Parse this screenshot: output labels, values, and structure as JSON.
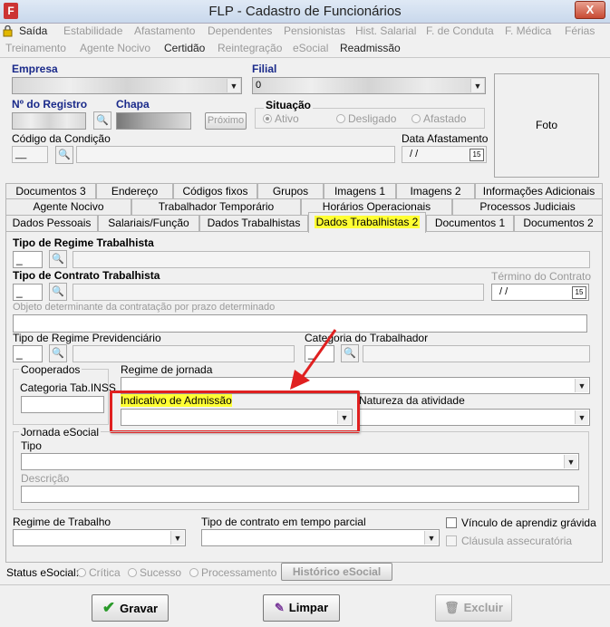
{
  "window": {
    "title": "FLP - Cadastro de Funcionários",
    "close_label": "X",
    "icon_label": "F"
  },
  "menu": {
    "row1": [
      "Saída",
      "Estabilidade",
      "Afastamento",
      "Dependentes",
      "Pensionistas",
      "Hist. Salarial",
      "F. de Conduta",
      "F. Médica",
      "Férias"
    ],
    "row2": [
      "Treinamento",
      "Agente Nocivo",
      "Certidão",
      "Reintegração",
      "eSocial",
      "Readmissão"
    ]
  },
  "header": {
    "empresa_label": "Empresa",
    "filial_label": "Filial",
    "filial_prefix": "0",
    "registro_label": "Nº do Registro",
    "chapa_label": "Chapa",
    "proximo_label": "Próximo",
    "situacao_label": "Situação",
    "situacao_options": [
      "Ativo",
      "Desligado",
      "Afastado"
    ],
    "codigo_condicao_label": "Código da Condição",
    "codigo_condicao_value": "__",
    "data_afastamento_label": "Data Afastamento",
    "data_afastamento_value": "/ /",
    "foto_label": "Foto"
  },
  "tabs": {
    "row1": [
      "Documentos 3",
      "Endereço",
      "Códigos fixos",
      "Grupos",
      "Imagens 1",
      "Imagens 2",
      "Informações Adicionais"
    ],
    "row2": [
      "Agente Nocivo",
      "Trabalhador Temporário",
      "Horários Operacionais",
      "Processos Judiciais"
    ],
    "row3": [
      "Dados Pessoais",
      "Salariais/Função",
      "Dados Trabalhistas",
      "Dados Trabalhistas 2",
      "Documentos 1",
      "Documentos 2"
    ],
    "selected": "Dados Trabalhistas 2"
  },
  "form": {
    "tipo_regime_label": "Tipo de Regime Trabalhista",
    "tipo_regime_value": "_",
    "tipo_contrato_label": "Tipo de Contrato Trabalhista",
    "tipo_contrato_value": "_",
    "termino_contrato_label": "Término do Contrato",
    "termino_contrato_value": "/ /",
    "objeto_label": "Objeto determinante da contratação por prazo determinado",
    "tipo_regime_prev_label": "Tipo de Regime Previdenciário",
    "tipo_regime_prev_value": "_",
    "categoria_trabalhador_label": "Categoria do Trabalhador",
    "categoria_trabalhador_value": "_",
    "cooperados_label": "Cooperados",
    "categoria_tab_inss_label": "Categoria Tab.INSS",
    "regime_jornada_label": "Regime de jornada",
    "indicativo_admissao_label": "Indicativo de Admissão",
    "natureza_atividade_label": "Natureza da atividade",
    "jornada_esocial_label": "Jornada eSocial",
    "tipo_label": "Tipo",
    "descricao_label": "Descrição",
    "regime_trabalho_label": "Regime de Trabalho",
    "tipo_contrato_parcial_label": "Tipo de contrato em tempo parcial",
    "vinculo_aprendiz_label": "Vínculo de aprendiz grávida",
    "clausula_label": "Cláusula assecuratória"
  },
  "status": {
    "label": "Status eSocial:",
    "options": [
      "Crítica",
      "Sucesso",
      "Processamento"
    ],
    "historico_label": "Histórico eSocial"
  },
  "footer": {
    "gravar_label": "Gravar",
    "limpar_label": "Limpar",
    "excluir_label": "Excluir"
  },
  "colors": {
    "highlight": "#ffff33",
    "annotation_red": "#e02020",
    "label_blue": "#1a2a8a"
  }
}
